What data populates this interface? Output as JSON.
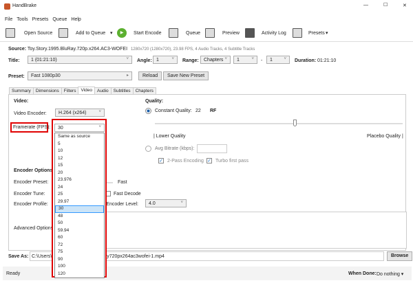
{
  "window": {
    "title": "HandBrake",
    "minimize": "—",
    "maximize": "☐",
    "close": "✕"
  },
  "menu": [
    "File",
    "Tools",
    "Presets",
    "Queue",
    "Help"
  ],
  "toolbar": {
    "open_source": "Open Source",
    "add_to_queue": "Add to Queue",
    "start_encode": "Start Encode",
    "queue": "Queue",
    "preview": "Preview",
    "activity_log": "Activity Log",
    "presets": "Presets",
    "dropdown": "▾"
  },
  "source": {
    "label": "Source:",
    "name": "Toy.Story.1995.BluRay.720p.x264.AC3-WOFEI",
    "info": "1280x720 (1280x720), 23.98 FPS, 4 Audio Tracks, 4 Subtitle Tracks"
  },
  "title_row": {
    "title_label": "Title:",
    "title_value": "1 (01:21:10)",
    "angle_label": "Angle:",
    "angle_value": "1",
    "range_label": "Range:",
    "range_value": "Chapters",
    "range_start": "1",
    "range_sep": "-",
    "range_end": "1",
    "duration_label": "Duration:",
    "duration_value": "01:21:10"
  },
  "preset": {
    "label": "Preset:",
    "value": "Fast 1080p30",
    "reload": "Reload",
    "save_new": "Save New Preset"
  },
  "tabs": [
    "Summary",
    "Dimensions",
    "Filters",
    "Video",
    "Audio",
    "Subtitles",
    "Chapters"
  ],
  "active_tab": "Video",
  "video": {
    "heading": "Video:",
    "encoder_label": "Video Encoder:",
    "encoder_value": "H.264 (x264)",
    "framerate_label": "Framerate (FPS):",
    "framerate_value": "30",
    "framerate_options": [
      "Same as source",
      "5",
      "10",
      "12",
      "15",
      "20",
      "23.976",
      "24",
      "25",
      "29.97",
      "30",
      "48",
      "50",
      "59.94",
      "60",
      "72",
      "75",
      "90",
      "100",
      "120"
    ],
    "selected_option": "30"
  },
  "quality": {
    "heading": "Quality:",
    "cq_label": "Constant Quality:",
    "cq_value": "22",
    "cq_unit": "RF",
    "lower": "| Lower Quality",
    "placebo": "Placebo Quality |",
    "slider_value_rf": 22,
    "avg_bitrate_label": "Avg Bitrate (kbps):",
    "two_pass": "2-Pass Encoding",
    "turbo": "Turbo first pass"
  },
  "encoder_options": {
    "heading": "Encoder Options",
    "preset_label": "Encoder Preset:",
    "preset_value": "Fast",
    "tune_label": "Encoder Tune:",
    "fast_decode": "Fast Decode",
    "profile_label": "Encoder Profile:",
    "level_label": "Encoder Level:",
    "level_value": "4.0",
    "advanced_label": "Advanced Options:"
  },
  "save_as": {
    "label": "Save As:",
    "value_start": "C:\\Users\\p",
    "value_end": "ray720px264ac3wofei-1.mp4",
    "browse": "Browse"
  },
  "status": {
    "text": "Ready",
    "when_done_label": "When Done:",
    "when_done_value": "Do nothing ▾"
  },
  "colors": {
    "highlight": "#e00000",
    "accent": "#1a73c7"
  }
}
